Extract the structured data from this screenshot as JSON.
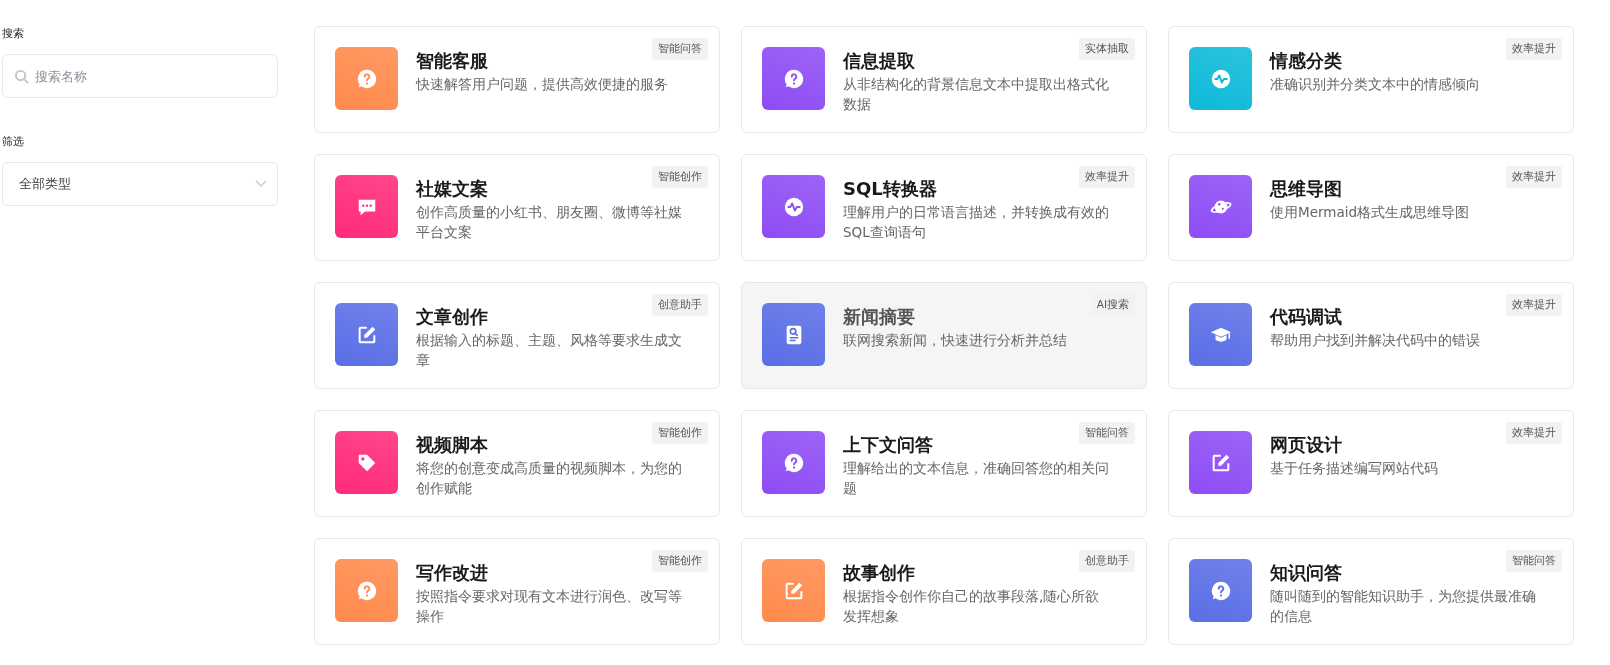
{
  "sidebar": {
    "search_label": "搜索",
    "search": {
      "placeholder": "搜索名称"
    },
    "filter_label": "筛选",
    "filter": {
      "value": "全部类型"
    }
  },
  "apps": [
    {
      "title": "智能客服",
      "description": "快速解答用户问题，提供高效便捷的服务",
      "tag": "智能问答",
      "kind": "question",
      "color": "#ff8a4c",
      "hovered": false
    },
    {
      "title": "信息提取",
      "description": "从非结构化的背景信息文本中提取出格式化数据",
      "tag": "实体抽取",
      "kind": "question",
      "color": "#8e4cf5",
      "hovered": false
    },
    {
      "title": "情感分类",
      "description": "准确识别并分类文本中的情感倾向",
      "tag": "效率提升",
      "kind": "pulse",
      "color": "#0cbad8",
      "hovered": false
    },
    {
      "title": "社媒文案",
      "description": "创作高质量的小红书、朋友圈、微博等社媒平台文案",
      "tag": "智能创作",
      "kind": "chat",
      "color": "#ff2a7a",
      "hovered": false
    },
    {
      "title": "SQL转换器",
      "description": "理解用户的日常语言描述，并转换成有效的SQL查询语句",
      "tag": "效率提升",
      "kind": "pulse",
      "color": "#8e4cf5",
      "hovered": false
    },
    {
      "title": "思维导图",
      "description": "使用Mermaid格式生成思维导图",
      "tag": "效率提升",
      "kind": "planet",
      "color": "#8e4cf5",
      "hovered": false
    },
    {
      "title": "文章创作",
      "description": "根据输入的标题、主题、风格等要求生成文章",
      "tag": "创意助手",
      "kind": "edit",
      "color": "#5a6ee6",
      "hovered": false
    },
    {
      "title": "新闻摘要",
      "description": "联网搜索新闻，快速进行分析并总结",
      "tag": "AI搜索",
      "kind": "doc-search",
      "color": "#5a6ee6",
      "hovered": true
    },
    {
      "title": "代码调试",
      "description": "帮助用户找到并解决代码中的错误",
      "tag": "效率提升",
      "kind": "cap",
      "color": "#5a6ee6",
      "hovered": false
    },
    {
      "title": "视频脚本",
      "description": "将您的创意变成高质量的视频脚本，为您的创作赋能",
      "tag": "智能创作",
      "kind": "tag",
      "color": "#ff2a7a",
      "hovered": false
    },
    {
      "title": "上下文问答",
      "description": "理解给出的文本信息，准确回答您的相关问题",
      "tag": "智能问答",
      "kind": "question",
      "color": "#8e4cf5",
      "hovered": false
    },
    {
      "title": "网页设计",
      "description": "基于任务描述编写网站代码",
      "tag": "效率提升",
      "kind": "edit",
      "color": "#8e4cf5",
      "hovered": false
    },
    {
      "title": "写作改进",
      "description": "按照指令要求对现有文本进行润色、改写等操作",
      "tag": "智能创作",
      "kind": "question",
      "color": "#ff8a4c",
      "hovered": false
    },
    {
      "title": "故事创作",
      "description": "根据指令创作你自己的故事段落,随心所欲发挥想象",
      "tag": "创意助手",
      "kind": "edit",
      "color": "#ff8a4c",
      "hovered": false
    },
    {
      "title": "知识问答",
      "description": "随叫随到的智能知识助手，为您提供最准确的信息",
      "tag": "智能问答",
      "kind": "question",
      "color": "#5a6ee6",
      "hovered": false
    }
  ]
}
